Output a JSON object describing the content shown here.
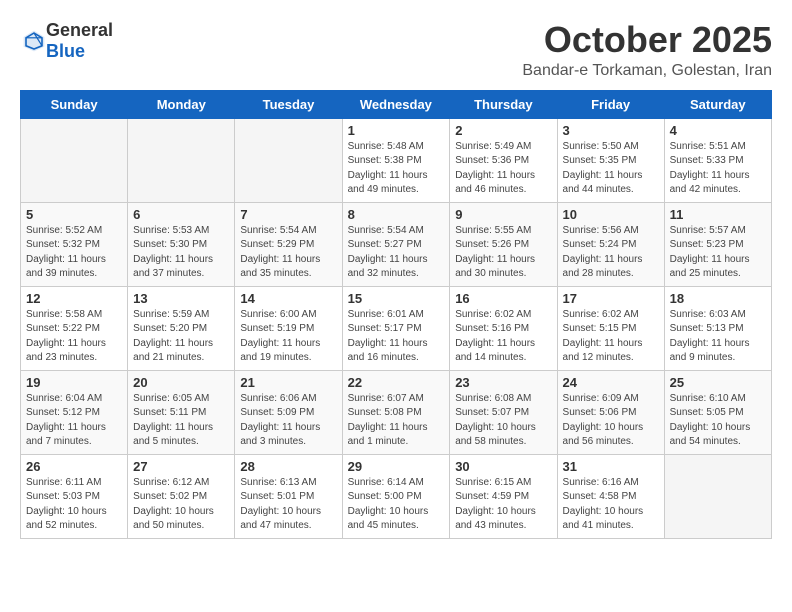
{
  "logo": {
    "general": "General",
    "blue": "Blue"
  },
  "header": {
    "month_year": "October 2025",
    "location": "Bandar-e Torkaman, Golestan, Iran"
  },
  "days_of_week": [
    "Sunday",
    "Monday",
    "Tuesday",
    "Wednesday",
    "Thursday",
    "Friday",
    "Saturday"
  ],
  "weeks": [
    [
      {
        "day": "",
        "info": ""
      },
      {
        "day": "",
        "info": ""
      },
      {
        "day": "",
        "info": ""
      },
      {
        "day": "1",
        "info": "Sunrise: 5:48 AM\nSunset: 5:38 PM\nDaylight: 11 hours\nand 49 minutes."
      },
      {
        "day": "2",
        "info": "Sunrise: 5:49 AM\nSunset: 5:36 PM\nDaylight: 11 hours\nand 46 minutes."
      },
      {
        "day": "3",
        "info": "Sunrise: 5:50 AM\nSunset: 5:35 PM\nDaylight: 11 hours\nand 44 minutes."
      },
      {
        "day": "4",
        "info": "Sunrise: 5:51 AM\nSunset: 5:33 PM\nDaylight: 11 hours\nand 42 minutes."
      }
    ],
    [
      {
        "day": "5",
        "info": "Sunrise: 5:52 AM\nSunset: 5:32 PM\nDaylight: 11 hours\nand 39 minutes."
      },
      {
        "day": "6",
        "info": "Sunrise: 5:53 AM\nSunset: 5:30 PM\nDaylight: 11 hours\nand 37 minutes."
      },
      {
        "day": "7",
        "info": "Sunrise: 5:54 AM\nSunset: 5:29 PM\nDaylight: 11 hours\nand 35 minutes."
      },
      {
        "day": "8",
        "info": "Sunrise: 5:54 AM\nSunset: 5:27 PM\nDaylight: 11 hours\nand 32 minutes."
      },
      {
        "day": "9",
        "info": "Sunrise: 5:55 AM\nSunset: 5:26 PM\nDaylight: 11 hours\nand 30 minutes."
      },
      {
        "day": "10",
        "info": "Sunrise: 5:56 AM\nSunset: 5:24 PM\nDaylight: 11 hours\nand 28 minutes."
      },
      {
        "day": "11",
        "info": "Sunrise: 5:57 AM\nSunset: 5:23 PM\nDaylight: 11 hours\nand 25 minutes."
      }
    ],
    [
      {
        "day": "12",
        "info": "Sunrise: 5:58 AM\nSunset: 5:22 PM\nDaylight: 11 hours\nand 23 minutes."
      },
      {
        "day": "13",
        "info": "Sunrise: 5:59 AM\nSunset: 5:20 PM\nDaylight: 11 hours\nand 21 minutes."
      },
      {
        "day": "14",
        "info": "Sunrise: 6:00 AM\nSunset: 5:19 PM\nDaylight: 11 hours\nand 19 minutes."
      },
      {
        "day": "15",
        "info": "Sunrise: 6:01 AM\nSunset: 5:17 PM\nDaylight: 11 hours\nand 16 minutes."
      },
      {
        "day": "16",
        "info": "Sunrise: 6:02 AM\nSunset: 5:16 PM\nDaylight: 11 hours\nand 14 minutes."
      },
      {
        "day": "17",
        "info": "Sunrise: 6:02 AM\nSunset: 5:15 PM\nDaylight: 11 hours\nand 12 minutes."
      },
      {
        "day": "18",
        "info": "Sunrise: 6:03 AM\nSunset: 5:13 PM\nDaylight: 11 hours\nand 9 minutes."
      }
    ],
    [
      {
        "day": "19",
        "info": "Sunrise: 6:04 AM\nSunset: 5:12 PM\nDaylight: 11 hours\nand 7 minutes."
      },
      {
        "day": "20",
        "info": "Sunrise: 6:05 AM\nSunset: 5:11 PM\nDaylight: 11 hours\nand 5 minutes."
      },
      {
        "day": "21",
        "info": "Sunrise: 6:06 AM\nSunset: 5:09 PM\nDaylight: 11 hours\nand 3 minutes."
      },
      {
        "day": "22",
        "info": "Sunrise: 6:07 AM\nSunset: 5:08 PM\nDaylight: 11 hours\nand 1 minute."
      },
      {
        "day": "23",
        "info": "Sunrise: 6:08 AM\nSunset: 5:07 PM\nDaylight: 10 hours\nand 58 minutes."
      },
      {
        "day": "24",
        "info": "Sunrise: 6:09 AM\nSunset: 5:06 PM\nDaylight: 10 hours\nand 56 minutes."
      },
      {
        "day": "25",
        "info": "Sunrise: 6:10 AM\nSunset: 5:05 PM\nDaylight: 10 hours\nand 54 minutes."
      }
    ],
    [
      {
        "day": "26",
        "info": "Sunrise: 6:11 AM\nSunset: 5:03 PM\nDaylight: 10 hours\nand 52 minutes."
      },
      {
        "day": "27",
        "info": "Sunrise: 6:12 AM\nSunset: 5:02 PM\nDaylight: 10 hours\nand 50 minutes."
      },
      {
        "day": "28",
        "info": "Sunrise: 6:13 AM\nSunset: 5:01 PM\nDaylight: 10 hours\nand 47 minutes."
      },
      {
        "day": "29",
        "info": "Sunrise: 6:14 AM\nSunset: 5:00 PM\nDaylight: 10 hours\nand 45 minutes."
      },
      {
        "day": "30",
        "info": "Sunrise: 6:15 AM\nSunset: 4:59 PM\nDaylight: 10 hours\nand 43 minutes."
      },
      {
        "day": "31",
        "info": "Sunrise: 6:16 AM\nSunset: 4:58 PM\nDaylight: 10 hours\nand 41 minutes."
      },
      {
        "day": "",
        "info": ""
      }
    ]
  ]
}
